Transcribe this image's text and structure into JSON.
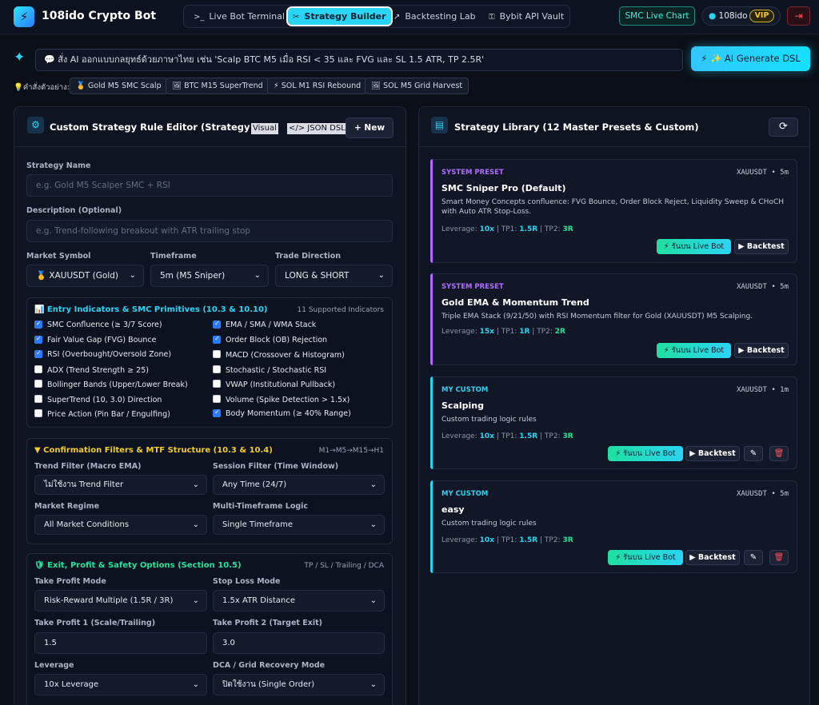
{
  "header": {
    "brand": "108ido Crypto Bot",
    "tabs": [
      {
        "icon": ">_",
        "label": "Live Bot Terminal"
      },
      {
        "icon": "✂",
        "label": "Strategy Builder"
      },
      {
        "icon": "↗",
        "label": "Backtesting Lab"
      },
      {
        "icon": "⚿",
        "label": "Bybit API Vault"
      }
    ],
    "active_tab": "Strategy Builder",
    "smc_button": "SMC Live Chart",
    "username": "108ido",
    "badge": "VIP"
  },
  "ai": {
    "prompt": "💬 สั่ง AI ออกแบบกลยุทธ์ด้วยภาษาไทย เช่น 'Scalp BTC M5 เมื่อ RSI < 35 และ FVG และ SL 1.5 ATR, TP 2.5R'",
    "generate_label": "✨ AI Generate DSL",
    "examples_label": "💡คำสั่งตัวอย่าง:",
    "examples": [
      "🥇 Gold M5 SMC Scalp",
      "🖼 BTC M15 SuperTrend",
      "⚡ SOL M1 RSI Rebound",
      "🖼 SOL M5 Grid Harvest"
    ]
  },
  "editor": {
    "title": "Custom Strategy Rule Editor (Strategy DSL)",
    "mode_visual": "Visual",
    "mode_json": "</> JSON DSL",
    "new_label": "+ New",
    "name_label": "Strategy Name",
    "name_placeholder": "e.g. Gold M5 Scalper SMC + RSI",
    "desc_label": "Description (Optional)",
    "desc_placeholder": "e.g. Trend-following breakout with ATR trailing stop",
    "symbol_label": "Market Symbol",
    "symbol_value": "🥇 XAUUSDT (Gold)",
    "timeframe_label": "Timeframe",
    "timeframe_value": "5m (M5 Sniper)",
    "direction_label": "Trade Direction",
    "direction_value": "LONG & SHORT",
    "entry": {
      "title": "📊 Entry Indicators & SMC Primitives (10.3 & 10.10)",
      "count": "11 Supported Indicators",
      "items": [
        {
          "label": "SMC Confluence (≥ 3/7 Score)",
          "checked": true
        },
        {
          "label": "EMA / SMA / WMA Stack",
          "checked": true
        },
        {
          "label": "Fair Value Gap (FVG) Bounce",
          "checked": true
        },
        {
          "label": "Order Block (OB) Rejection",
          "checked": true
        },
        {
          "label": "RSI (Overbought/Oversold Zone)",
          "checked": true
        },
        {
          "label": "MACD (Crossover & Histogram)",
          "checked": false
        },
        {
          "label": "ADX (Trend Strength ≥ 25)",
          "checked": false
        },
        {
          "label": "Stochastic / Stochastic RSI",
          "checked": false
        },
        {
          "label": "Bollinger Bands (Upper/Lower Break)",
          "checked": false
        },
        {
          "label": "VWAP (Institutional Pullback)",
          "checked": false
        },
        {
          "label": "SuperTrend (10, 3.0) Direction",
          "checked": false
        },
        {
          "label": "Volume (Spike Detection > 1.5x)",
          "checked": false
        },
        {
          "label": "Price Action (Pin Bar / Engulfing)",
          "checked": false
        },
        {
          "label": "Body Momentum (≥ 40% Range)",
          "checked": true
        }
      ]
    },
    "confirm": {
      "title": "▼ Confirmation Filters & MTF Structure (10.3 & 10.4)",
      "right": "M1→M5→M15→H1",
      "trend_label": "Trend Filter (Macro EMA)",
      "trend_value": "ไม่ใช้งาน Trend Filter",
      "session_label": "Session Filter (Time Window)",
      "session_value": "Any Time (24/7)",
      "regime_label": "Market Regime",
      "regime_value": "All Market Conditions",
      "mtf_label": "Multi-Timeframe Logic",
      "mtf_value": "Single Timeframe"
    },
    "exit": {
      "title": "🛡 Exit, Profit & Safety Options (Section 10.5)",
      "right": "TP / SL / Trailing / DCA",
      "tp_mode_label": "Take Profit Mode",
      "tp_mode_value": "Risk-Reward Multiple (1.5R / 3R)",
      "sl_mode_label": "Stop Loss Mode",
      "sl_mode_value": "1.5x ATR Distance",
      "tp1_label": "Take Profit 1 (Scale/Trailing)",
      "tp1_value": "1.5",
      "tp2_label": "Take Profit 2 (Target Exit)",
      "tp2_value": "3.0",
      "lev_label": "Leverage",
      "lev_value": "10x Leverage",
      "dca_label": "DCA / Grid Recovery Mode",
      "dca_value": "ปิดใช้งาน (Single Order)"
    }
  },
  "library": {
    "title": "Strategy Library (12 Master Presets & Custom)",
    "live_label": "⚡ รันบน Live Bot",
    "backtest_label": "▶ Backtest",
    "cards": [
      {
        "tag": "SYSTEM PRESET",
        "symbol": "XAUUSDT • 5m",
        "title": "SMC Sniper Pro (Default)",
        "desc": "Smart Money Concepts confluence: FVG Bounce, Order Block Reject, Liquidity Sweep & CHoCH with Auto ATR Stop-Loss.",
        "leverage": "10x",
        "tp1": "1.5R",
        "tp2": "3R"
      },
      {
        "tag": "SYSTEM PRESET",
        "symbol": "XAUUSDT • 5m",
        "title": "Gold EMA & Momentum Trend",
        "desc": "Triple EMA Stack (9/21/50) with RSI Momentum filter for Gold (XAUUSDT) M5 Scalping.",
        "leverage": "15x",
        "tp1": "1R",
        "tp2": "2R"
      },
      {
        "tag": "MY CUSTOM",
        "symbol": "XAUUSDT • 1m",
        "title": "Scalping",
        "desc": "Custom trading logic rules",
        "leverage": "10x",
        "tp1": "1.5R",
        "tp2": "3R"
      },
      {
        "tag": "MY CUSTOM",
        "symbol": "XAUUSDT • 5m",
        "title": "easy",
        "desc": "Custom trading logic rules",
        "leverage": "10x",
        "tp1": "1.5R",
        "tp2": "3R"
      }
    ]
  },
  "colors": {
    "accent": "#2ad4f5",
    "preset": "#b06cff",
    "custom": "#2ad4f5",
    "green": "#22e39a"
  }
}
